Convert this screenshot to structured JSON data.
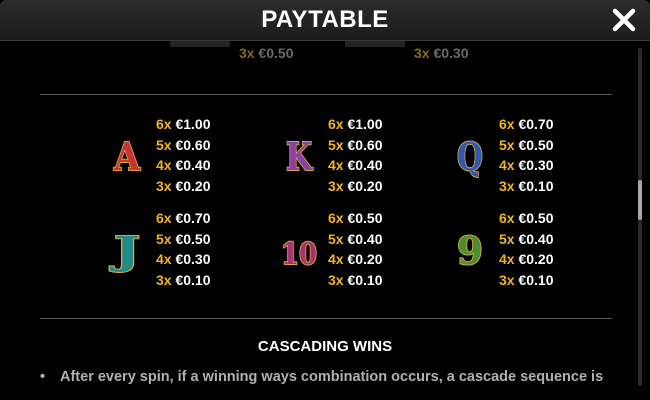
{
  "header": {
    "title": "PAYTABLE"
  },
  "partial_pays": [
    {
      "mult": "3x",
      "value": "€0.50"
    },
    {
      "mult": "3x",
      "value": "€0.30"
    }
  ],
  "symbols": [
    {
      "name": "A",
      "color": "#c8342f",
      "pays": [
        {
          "mult": "6x",
          "value": "€1.00"
        },
        {
          "mult": "5x",
          "value": "€0.60"
        },
        {
          "mult": "4x",
          "value": "€0.40"
        },
        {
          "mult": "3x",
          "value": "€0.20"
        }
      ]
    },
    {
      "name": "K",
      "color": "#8a3ea8",
      "pays": [
        {
          "mult": "6x",
          "value": "€1.00"
        },
        {
          "mult": "5x",
          "value": "€0.60"
        },
        {
          "mult": "4x",
          "value": "€0.40"
        },
        {
          "mult": "3x",
          "value": "€0.20"
        }
      ]
    },
    {
      "name": "Q",
      "color": "#2d5bb0",
      "pays": [
        {
          "mult": "6x",
          "value": "€0.70"
        },
        {
          "mult": "5x",
          "value": "€0.50"
        },
        {
          "mult": "4x",
          "value": "€0.30"
        },
        {
          "mult": "3x",
          "value": "€0.10"
        }
      ]
    },
    {
      "name": "J",
      "color": "#1f8c8c",
      "pays": [
        {
          "mult": "6x",
          "value": "€0.70"
        },
        {
          "mult": "5x",
          "value": "€0.50"
        },
        {
          "mult": "4x",
          "value": "€0.30"
        },
        {
          "mult": "3x",
          "value": "€0.10"
        }
      ]
    },
    {
      "name": "10",
      "color": "#a8326e",
      "pays": [
        {
          "mult": "6x",
          "value": "€0.50"
        },
        {
          "mult": "5x",
          "value": "€0.40"
        },
        {
          "mult": "4x",
          "value": "€0.20"
        },
        {
          "mult": "3x",
          "value": "€0.10"
        }
      ]
    },
    {
      "name": "9",
      "color": "#4a8f2f",
      "pays": [
        {
          "mult": "6x",
          "value": "€0.50"
        },
        {
          "mult": "5x",
          "value": "€0.40"
        },
        {
          "mult": "4x",
          "value": "€0.20"
        },
        {
          "mult": "3x",
          "value": "€0.10"
        }
      ]
    }
  ],
  "cascading": {
    "title": "CASCADING WINS",
    "text": "After every spin, if a winning ways combination occurs, a cascade sequence is"
  },
  "colors": {
    "accent": "#f4b41a",
    "symbol_border": "#d9a441"
  }
}
